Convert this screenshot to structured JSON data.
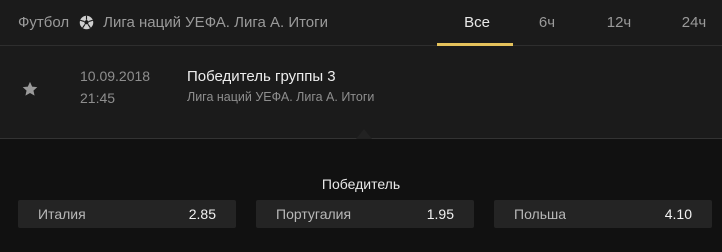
{
  "header": {
    "sport": "Футбол",
    "league": "Лига наций УЕФА. Лига А. Итоги",
    "tabs": [
      {
        "label": "Все",
        "active": true
      },
      {
        "label": "6ч",
        "active": false
      },
      {
        "label": "12ч",
        "active": false
      },
      {
        "label": "24ч",
        "active": false
      }
    ],
    "accent_color": "#e5c25c"
  },
  "event": {
    "date": "10.09.2018",
    "time": "21:45",
    "title": "Победитель группы 3",
    "subtitle": "Лига наций УЕФА. Лига А. Итоги",
    "favorite_icon": "star-icon"
  },
  "market": {
    "title": "Победитель",
    "odds": [
      {
        "name": "Италия",
        "value": "2.85"
      },
      {
        "name": "Португалия",
        "value": "1.95"
      },
      {
        "name": "Польша",
        "value": "4.10"
      }
    ]
  }
}
